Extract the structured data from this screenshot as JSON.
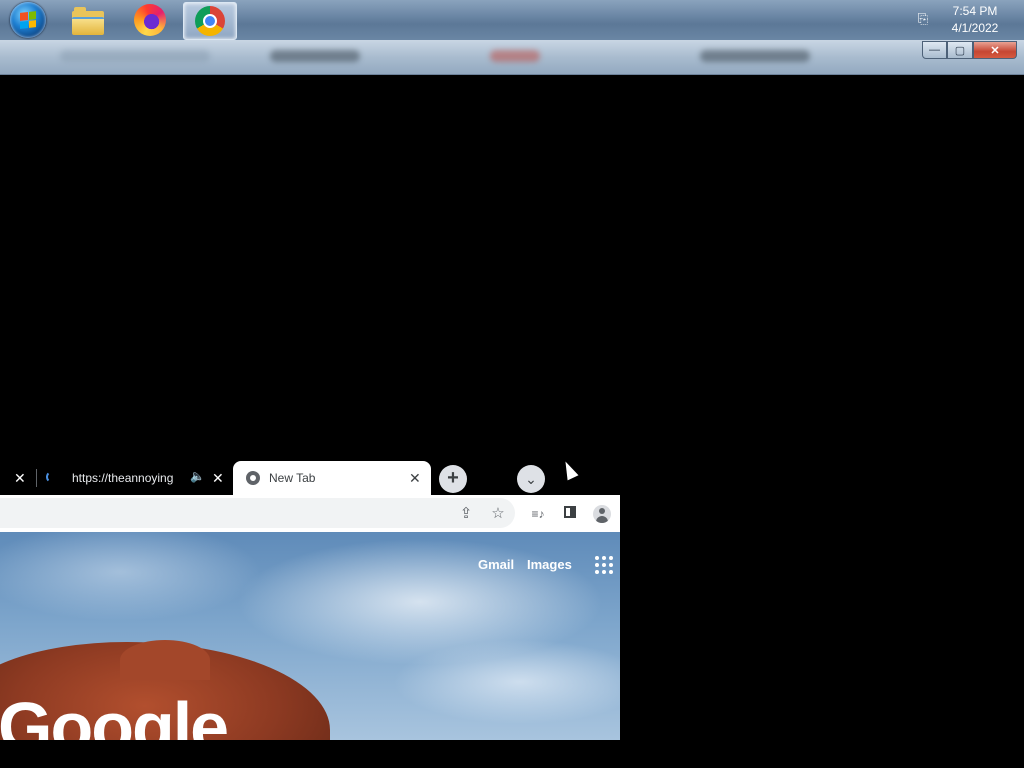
{
  "taskbar": {
    "apps": [
      {
        "name": "start-button"
      },
      {
        "name": "windows-explorer"
      },
      {
        "name": "firefox"
      },
      {
        "name": "google-chrome",
        "active": true
      }
    ],
    "clock": {
      "time": "7:54 PM",
      "date": "4/1/2022"
    }
  },
  "window_controls": {
    "minimize": "—",
    "maximize": "▢",
    "close": "✕"
  },
  "browser": {
    "tabs": [
      {
        "title": "",
        "close": "✕"
      },
      {
        "title": "https://theannoying",
        "audio_icon": "🔈",
        "close": "✕"
      },
      {
        "title": "New Tab",
        "close": "✕",
        "active": true
      }
    ],
    "new_tab_symbol": "+",
    "tab_search_symbol": "⌄",
    "toolbar_icons": [
      "share-icon",
      "star-icon",
      "media-icon",
      "side-panel-icon",
      "profile-icon"
    ],
    "toolbar_glyphs": {
      "share": "⇪",
      "star": "☆",
      "media": "≡♪"
    },
    "ntp": {
      "gmail": "Gmail",
      "images": "Images",
      "logo": "Google"
    }
  }
}
